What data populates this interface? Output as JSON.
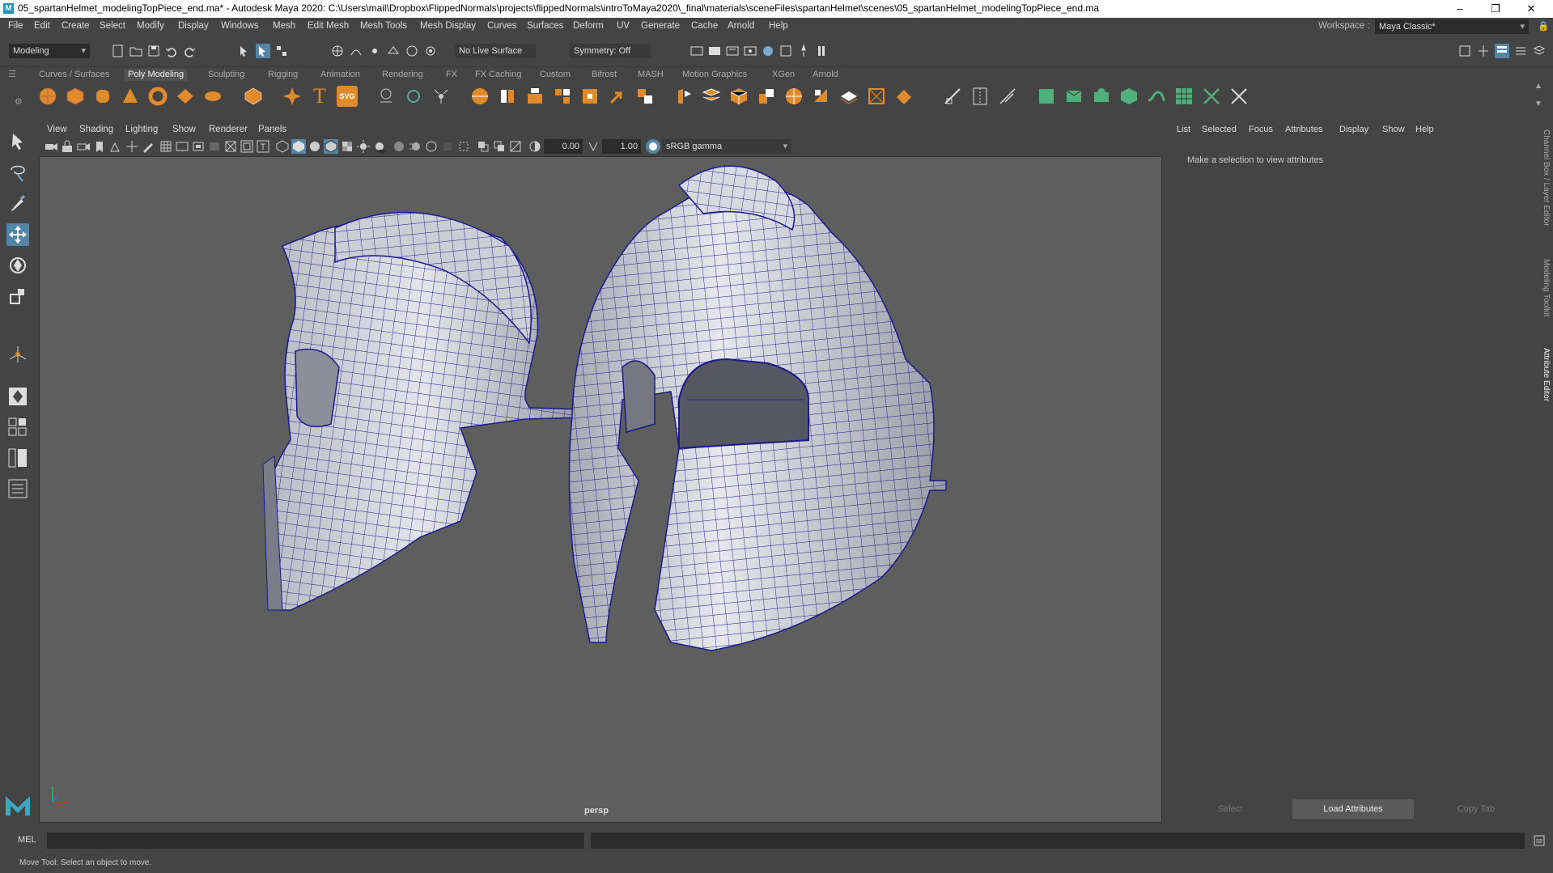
{
  "window": {
    "app_icon": "M",
    "title": "05_spartanHelmet_modelingTopPiece_end.ma* - Autodesk Maya 2020: C:\\Users\\mail\\Dropbox\\FlippedNormals\\projects\\flippedNormals\\introToMaya2020\\_final\\materials\\sceneFiles\\spartanHelmet\\scenes\\05_spartanHelmet_modelingTopPiece_end.ma",
    "minimize": "–",
    "restore": "❐",
    "close": "✕"
  },
  "menubar": {
    "items": [
      "File",
      "Edit",
      "Create",
      "Select",
      "Modify",
      "Display",
      "Windows",
      "Mesh",
      "Edit Mesh",
      "Mesh Tools",
      "Mesh Display",
      "Curves",
      "Surfaces",
      "Deform",
      "UV",
      "Generate",
      "Cache",
      "Arnold",
      "Help"
    ],
    "workspace_label": "Workspace :",
    "workspace_value": "Maya Classic*"
  },
  "statusline": {
    "menuset": "Modeling",
    "live_surface": "No Live Surface",
    "symmetry": "Symmetry: Off"
  },
  "shelf": {
    "tabs": [
      "Curves / Surfaces",
      "Poly Modeling",
      "Sculpting",
      "Rigging",
      "Animation",
      "Rendering",
      "FX",
      "FX Caching",
      "Custom",
      "Bifrost",
      "MASH",
      "Motion Graphics",
      "XGen",
      "Arnold"
    ],
    "active_tab": "Poly Modeling",
    "svg_icon_text": "SVG",
    "text_icon_text": "T"
  },
  "viewport": {
    "menus": [
      "View",
      "Shading",
      "Lighting",
      "Show",
      "Renderer",
      "Panels"
    ],
    "exposure": "0.00",
    "gamma": "1.00",
    "color_space": "sRGB gamma",
    "camera_label": "persp"
  },
  "attribute_editor": {
    "menus": [
      "List",
      "Selected",
      "Focus",
      "Attributes",
      "Display",
      "Show",
      "Help"
    ],
    "message": "Make a selection to view attributes",
    "buttons": [
      "Select",
      "Load Attributes",
      "Copy Tab"
    ]
  },
  "side_tabs": [
    "Channel Box / Layer Editor",
    "Modeling Toolkit",
    "Attribute Editor"
  ],
  "command_line": {
    "language": "MEL"
  },
  "help_line": {
    "text": "Move Tool: Select an object to move."
  },
  "colors": {
    "accent": "#5285a6",
    "shelf_orange": "#e08a2c",
    "shelf_green": "#4fb07a",
    "wire": "#1a1a8c"
  }
}
